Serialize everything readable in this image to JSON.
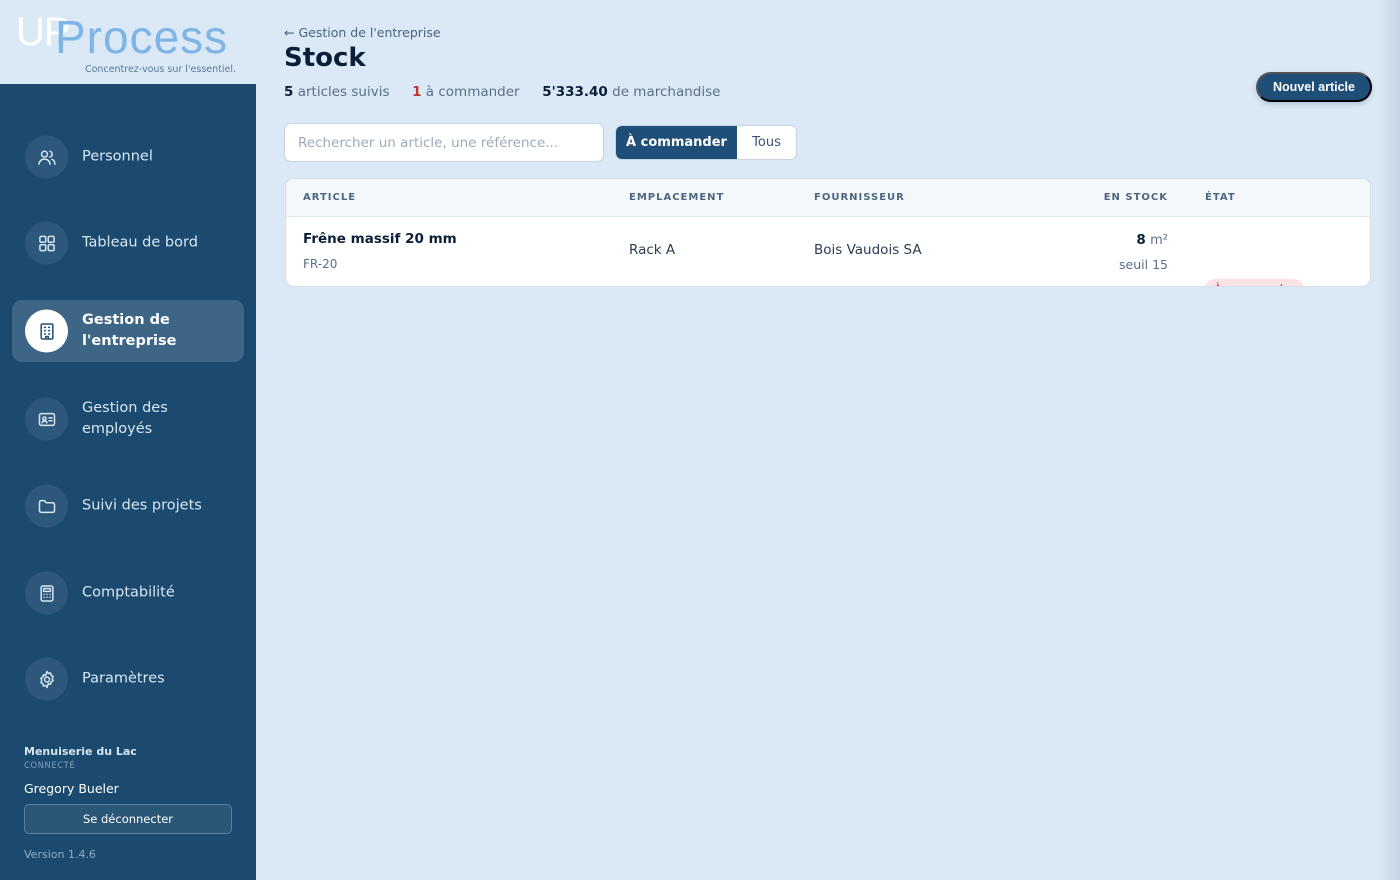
{
  "logo": {
    "part1": "UP",
    "part2": "Process",
    "tagline": "Concentrez-vous sur l'essentiel."
  },
  "sidebar": {
    "items": [
      {
        "label": "Personnel",
        "icon": "users-icon"
      },
      {
        "label": "Tableau de bord",
        "icon": "grid-icon"
      },
      {
        "label": "Gestion de l'entreprise",
        "icon": "building-icon",
        "active": true
      },
      {
        "label": "Gestion des employés",
        "icon": "id-card-icon"
      },
      {
        "label": "Suivi des projets",
        "icon": "folder-icon"
      },
      {
        "label": "Comptabilité",
        "icon": "calculator-icon"
      },
      {
        "label": "Paramètres",
        "icon": "gear-icon"
      }
    ],
    "company": "Menuiserie du Lac",
    "status": "CONNECTÉ",
    "user": "Gregory Bueler",
    "logout_label": "Se déconnecter",
    "version": "Version 1.4.6"
  },
  "header": {
    "back_label": "← Gestion de l'entreprise",
    "title": "Stock",
    "stats": {
      "tracked_count": "5",
      "tracked_label": "articles suivis",
      "to_order_count": "1",
      "to_order_label": "à commander",
      "value": "5'333.40",
      "value_label": "de marchandise"
    },
    "new_button": "Nouvel article"
  },
  "filters": {
    "search_placeholder": "Rechercher un article, une référence...",
    "segments": [
      "À commander",
      "Tous"
    ],
    "active_segment": "À commander"
  },
  "table": {
    "columns": [
      "ARTICLE",
      "EMPLACEMENT",
      "FOURNISSEUR",
      "EN STOCK",
      "ÉTAT"
    ],
    "rows": [
      {
        "name": "Frêne massif 20 mm",
        "ref": "FR-20",
        "location": "Rack A",
        "supplier": "Bois Vaudois SA",
        "qty": "8",
        "unit": "m²",
        "threshold": "seuil 15",
        "status": "À commander"
      }
    ]
  },
  "colors": {
    "sidebar_bg": "#1c4a6e",
    "accent": "#1f4e79",
    "page_bg": "#dbe8f5",
    "alert": "#c0392b",
    "alert_bg": "#fbe3e3"
  }
}
